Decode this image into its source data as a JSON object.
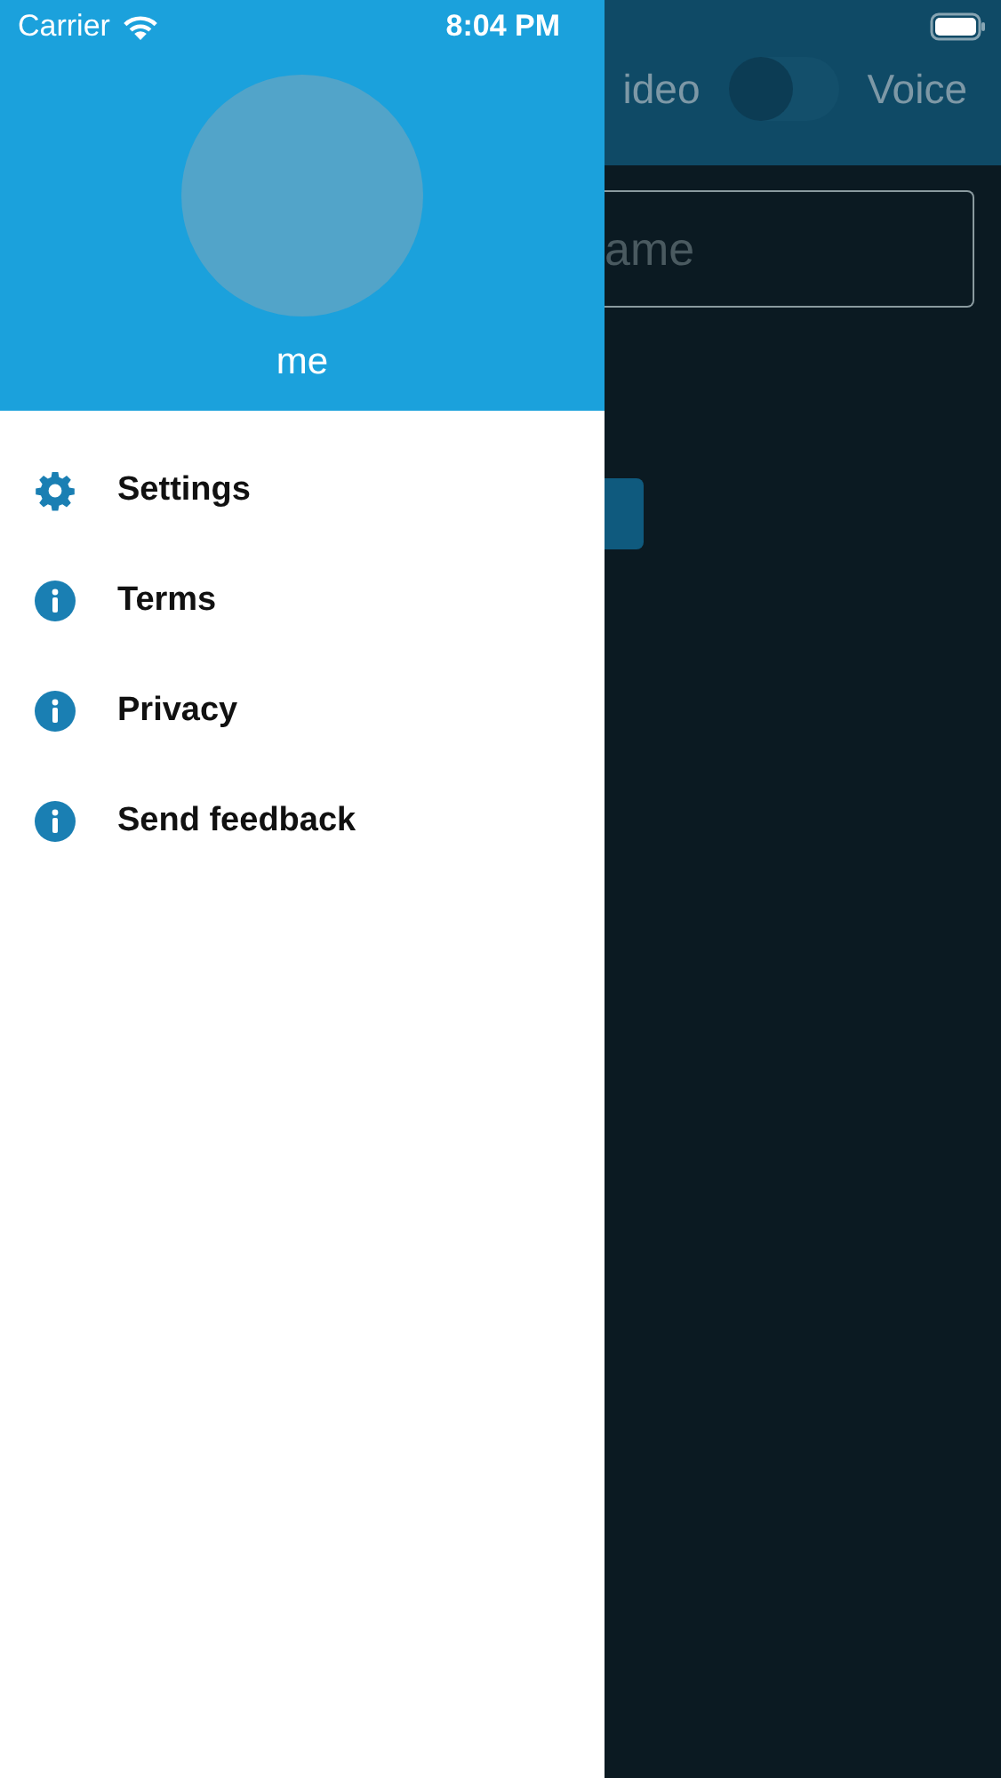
{
  "status_bar": {
    "carrier": "Carrier",
    "time": "8:04 PM"
  },
  "background_screen": {
    "mode_left": "ideo",
    "mode_switch": {
      "on": false
    },
    "mode_right": "Voice",
    "name_field": {
      "placeholder": "ame"
    }
  },
  "drawer": {
    "user_name": "me",
    "items": [
      {
        "label": "Settings",
        "kind": "settings"
      },
      {
        "label": "Terms",
        "kind": "info"
      },
      {
        "label": "Privacy",
        "kind": "info"
      },
      {
        "label": "Send feedback",
        "kind": "info"
      }
    ]
  }
}
